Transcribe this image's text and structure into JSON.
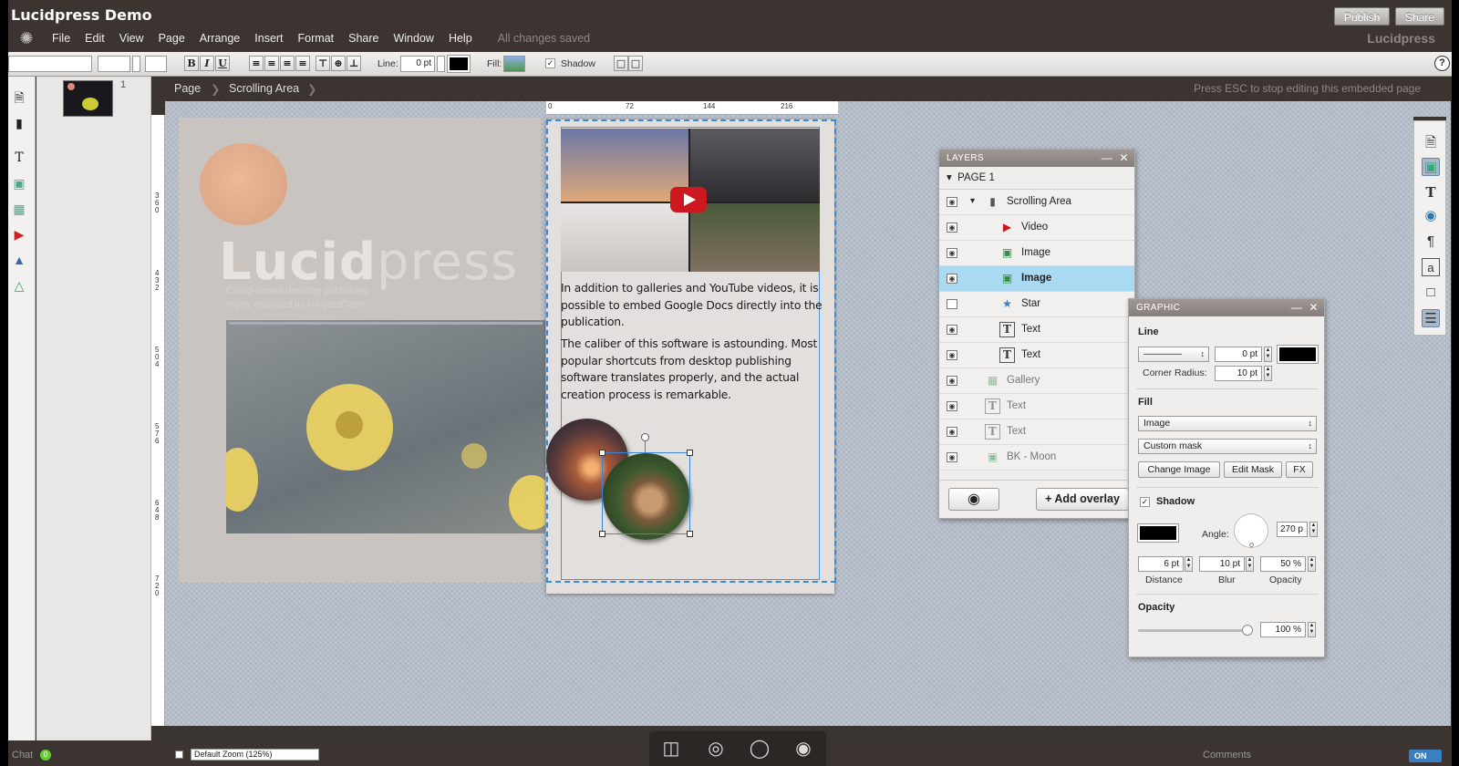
{
  "app": {
    "title": "Lucidpress Demo",
    "logo_text": "Lucidpress",
    "publish_label": "Publish",
    "share_label": "Share",
    "save_status": "All changes saved"
  },
  "menu": [
    "File",
    "Edit",
    "View",
    "Page",
    "Arrange",
    "Insert",
    "Format",
    "Share",
    "Window",
    "Help"
  ],
  "toolbar": {
    "line_label": "Line:",
    "line_value": "0 pt",
    "fill_label": "Fill:",
    "shadow_label": "Shadow",
    "shadow_checked": true,
    "bold": "B",
    "italic": "I",
    "underline": "U"
  },
  "pages": {
    "thumb_number": "1"
  },
  "breadcrumb": {
    "items": [
      "Page",
      "Scrolling Area"
    ],
    "hint": "Press ESC to stop editing this embedded page"
  },
  "ruler": {
    "h_ticks": [
      "0",
      "72",
      "144",
      "216"
    ],
    "v_ticks": [
      "3 6 0",
      "4 3 2",
      "5 0 4",
      "5 7 6",
      "6 4 8",
      "7 2 0"
    ]
  },
  "background_page": {
    "brand_bold": "Lucid",
    "brand_light": "press",
    "tagline1": "Cloud-based desktop publishing",
    "tagline2": "Highly endorsed by FringeEdTech!"
  },
  "page_content": {
    "paragraph1": "In addition to galleries and YouTube videos, it is possible to embed Google Docs directly into the publication.",
    "paragraph2": "The caliber of this software is astounding. Most popular shortcuts from desktop publishing software translates properly, and the actual creation process is remarkable."
  },
  "layers": {
    "title": "LAYERS",
    "page_label": "PAGE 1",
    "items": [
      {
        "name": "Scrolling Area",
        "icon": "scroll-area-icon"
      },
      {
        "name": "Video",
        "icon": "youtube-icon"
      },
      {
        "name": "Image",
        "icon": "image-icon"
      },
      {
        "name": "Image",
        "icon": "image-icon"
      },
      {
        "name": "Star",
        "icon": "star-icon"
      },
      {
        "name": "Text",
        "icon": "text-icon"
      },
      {
        "name": "Text",
        "icon": "text-icon"
      },
      {
        "name": "Gallery",
        "icon": "gallery-icon"
      },
      {
        "name": "Text",
        "icon": "text-icon"
      },
      {
        "name": "Text",
        "icon": "text-icon"
      },
      {
        "name": "BK - Moon",
        "icon": "image-icon"
      }
    ],
    "add_overlay_label": "+ Add overlay"
  },
  "graphic": {
    "title": "GRAPHIC",
    "line_section": "Line",
    "line_width": "0 pt",
    "corner_radius_label": "Corner Radius:",
    "corner_radius": "10 pt",
    "fill_section": "Fill",
    "fill_type": "Image",
    "mask_type": "Custom mask",
    "change_image_label": "Change Image",
    "edit_mask_label": "Edit Mask",
    "fx_label": "FX",
    "shadow_label": "Shadow",
    "shadow_checked": true,
    "angle_label": "Angle:",
    "angle_value": "270 p",
    "distance_value": "6 pt",
    "blur_value": "10 pt",
    "shadow_opacity_value": "50 %",
    "distance_label": "Distance",
    "blur_label": "Blur",
    "opacity_label": "Opacity",
    "opacity_section": "Opacity",
    "opacity_value": "100 %",
    "opacity_fraction": 1.0
  },
  "bottom": {
    "chat_label": "Chat",
    "chat_count": "0",
    "zoom_label": "Default Zoom (125%)",
    "comments_label": "Comments",
    "toggle_label": "ON"
  },
  "colors": {
    "accent_blue": "#3d8ad0",
    "selected_row": "#a9daf2",
    "chrome_dark": "#3b3431",
    "youtube_red": "#cc181e"
  }
}
